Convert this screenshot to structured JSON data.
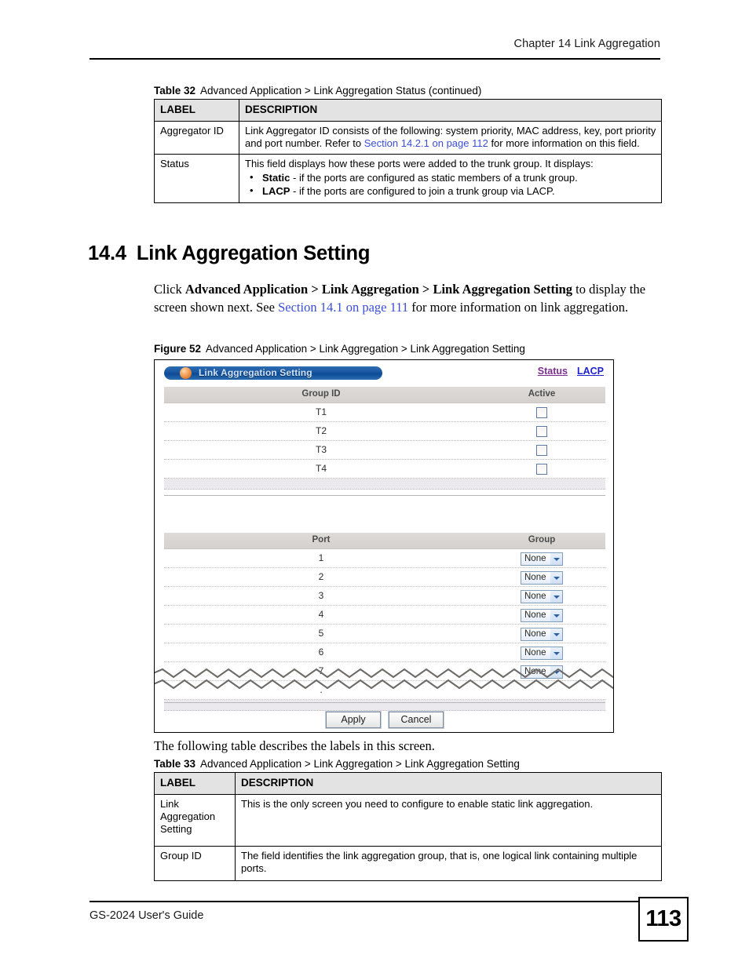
{
  "header": {
    "chapter": "Chapter 14 Link Aggregation"
  },
  "table32": {
    "caption_label": "Table 32",
    "caption_text": "Advanced Application > Link Aggregation Status  (continued)",
    "columns": [
      "LABEL",
      "DESCRIPTION"
    ],
    "rows": [
      {
        "label": "Aggregator ID",
        "desc_part1": "Link Aggregator ID consists of the following: system priority, MAC address, key, port priority and port number. Refer to ",
        "desc_link": "Section 14.2.1 on page 112",
        "desc_part2": " for more information on this field."
      },
      {
        "label": "Status",
        "desc_intro": "This field displays how these ports were added to the trunk group. It displays:",
        "bullets": [
          {
            "term": "Static",
            "rest": " - if the ports are configured as static members of a trunk group."
          },
          {
            "term": "LACP",
            "rest": " - if the ports are configured to join a trunk group via LACP."
          }
        ]
      }
    ]
  },
  "section": {
    "number": "14.4",
    "title": "Link Aggregation Setting",
    "paragraph": {
      "p1": "Click ",
      "b1": "Advanced Application",
      "sep1": " > ",
      "b2": "Link Aggregation",
      "sep2": " > ",
      "b3": "Link Aggregation Setting",
      "p2": " to display the screen shown next. See ",
      "link": "Section 14.1 on page 111",
      "p3": " for more information on link aggregation."
    }
  },
  "figure": {
    "caption_label": "Figure 52",
    "caption_text": "Advanced Application > Link Aggregation > Link Aggregation Setting",
    "screen": {
      "title": "Link Aggregation Setting",
      "nav_links": [
        {
          "label": "Status",
          "color": "#7c2f8f"
        },
        {
          "label": "LACP",
          "color": "#2020cc"
        }
      ],
      "group_table": {
        "headers": [
          "Group ID",
          "Active"
        ],
        "rows": [
          {
            "group_id": "T1",
            "active": false
          },
          {
            "group_id": "T2",
            "active": false
          },
          {
            "group_id": "T3",
            "active": false
          },
          {
            "group_id": "T4",
            "active": false
          }
        ]
      },
      "port_table": {
        "headers": [
          "Port",
          "Group"
        ],
        "rows": [
          {
            "port": "1",
            "group": "None"
          },
          {
            "port": "2",
            "group": "None"
          },
          {
            "port": "3",
            "group": "None"
          },
          {
            "port": "4",
            "group": "None"
          },
          {
            "port": "5",
            "group": "None"
          },
          {
            "port": "6",
            "group": "None"
          },
          {
            "port": "7",
            "group": "None"
          }
        ]
      },
      "buttons": [
        {
          "label": "Apply"
        },
        {
          "label": "Cancel"
        }
      ]
    }
  },
  "after_figure_text": "The following table describes the labels in this screen.",
  "table33": {
    "caption_label": "Table 33",
    "caption_text": "Advanced Application > Link Aggregation > Link Aggregation Setting",
    "columns": [
      "LABEL",
      "DESCRIPTION"
    ],
    "rows": [
      {
        "label": "Link Aggregation Setting",
        "desc": "This is the only screen you need to configure to enable static link aggregation."
      },
      {
        "label": "Group ID",
        "desc": "The field identifies the link aggregation group, that is, one logical link containing multiple ports."
      }
    ]
  },
  "footer": {
    "guide": "GS-2024 User's Guide",
    "page": "113"
  }
}
